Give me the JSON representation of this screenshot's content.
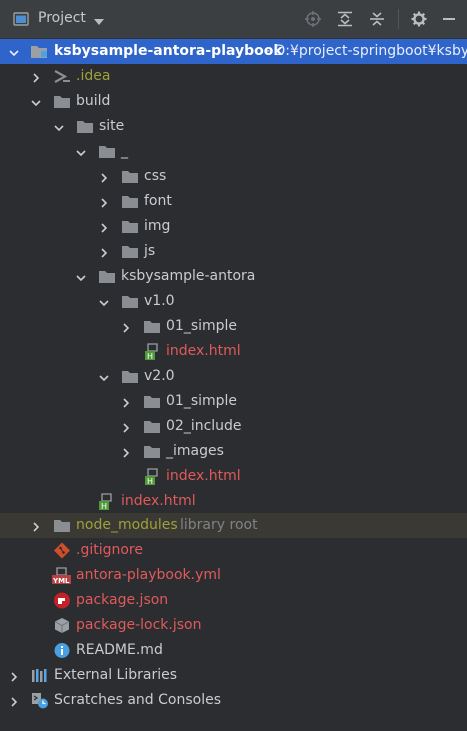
{
  "header": {
    "title": "Project",
    "icons": [
      "panel-icon",
      "dropdown-icon",
      "locate-icon",
      "expand-all-icon",
      "collapse-all-icon",
      "gear-icon",
      "hide-icon"
    ]
  },
  "tree": {
    "root": {
      "label": "ksbysample-antora-playbook",
      "path": "- D:¥project-springboot¥ksbys"
    },
    "idea": ".idea",
    "build": "build",
    "site": "site",
    "underscore": "_",
    "css": "css",
    "font": "font",
    "img": "img",
    "js": "js",
    "ksbysample_antora": "ksbysample-antora",
    "v1": "v1.0",
    "v1_simple": "01_simple",
    "v1_index": "index.html",
    "v2": "v2.0",
    "v2_simple": "01_simple",
    "v2_include": "02_include",
    "v2_images": "_images",
    "v2_index": "index.html",
    "site_index": "index.html",
    "node_modules": "node_modules",
    "node_modules_hint": "library root",
    "gitignore": ".gitignore",
    "playbook": "antora-playbook.yml",
    "package_json": "package.json",
    "package_lock": "package-lock.json",
    "readme": "README.md",
    "external_libraries": "External Libraries",
    "scratches": "Scratches and Consoles"
  },
  "colors": {
    "selection": "#2f65ca",
    "excluded_row": "#3a3934",
    "modified_file": "#e05a5a",
    "ignored_folder": "#a0a03a",
    "folder": "#8a8d91"
  }
}
